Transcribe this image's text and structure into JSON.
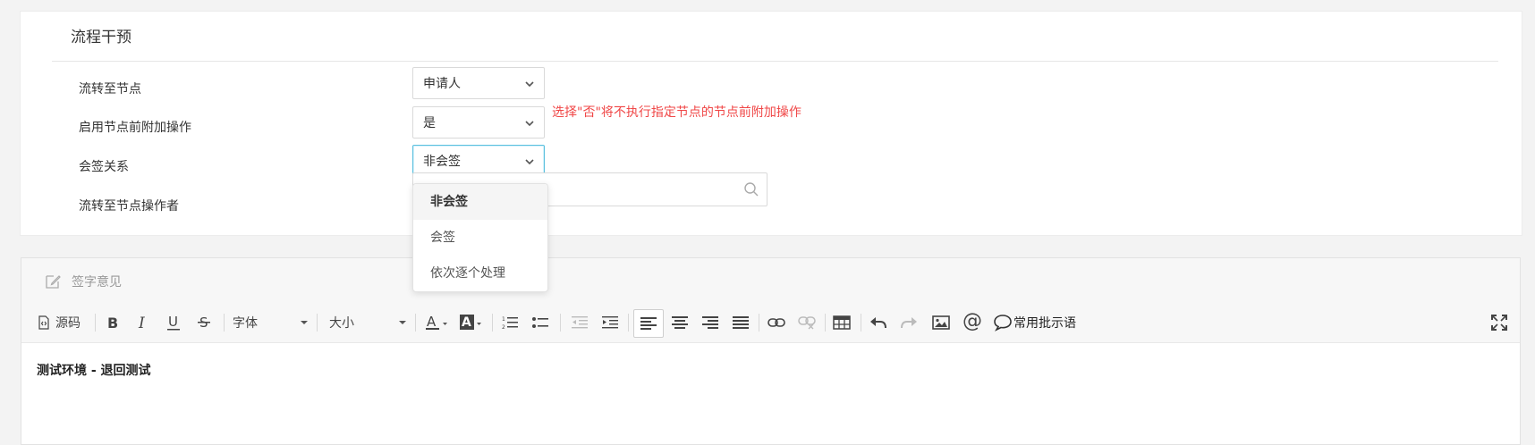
{
  "panel": {
    "title": "流程干预",
    "rows": [
      {
        "label": "流转至节点",
        "value": "申请人"
      },
      {
        "label": "启用节点前附加操作",
        "value": "是"
      },
      {
        "label": "会签关系",
        "value": "非会签"
      },
      {
        "label": "流转至节点操作者",
        "value": ""
      }
    ],
    "hint": "选择\"否\"将不执行指定节点的节点前附加操作",
    "hint_color": "#f04747",
    "focus_color": "#5bc0de"
  },
  "dropdown": {
    "options": [
      "非会签",
      "会签",
      "依次逐个处理"
    ],
    "selected": "非会签"
  },
  "editor": {
    "header_title": "签字意见",
    "toolbar": {
      "source_label": "源码",
      "font_label": "字体",
      "size_label": "大小",
      "phrases_label": "常用批示语",
      "at_symbol": "@"
    },
    "content": "测试环境 - 退回测试"
  }
}
